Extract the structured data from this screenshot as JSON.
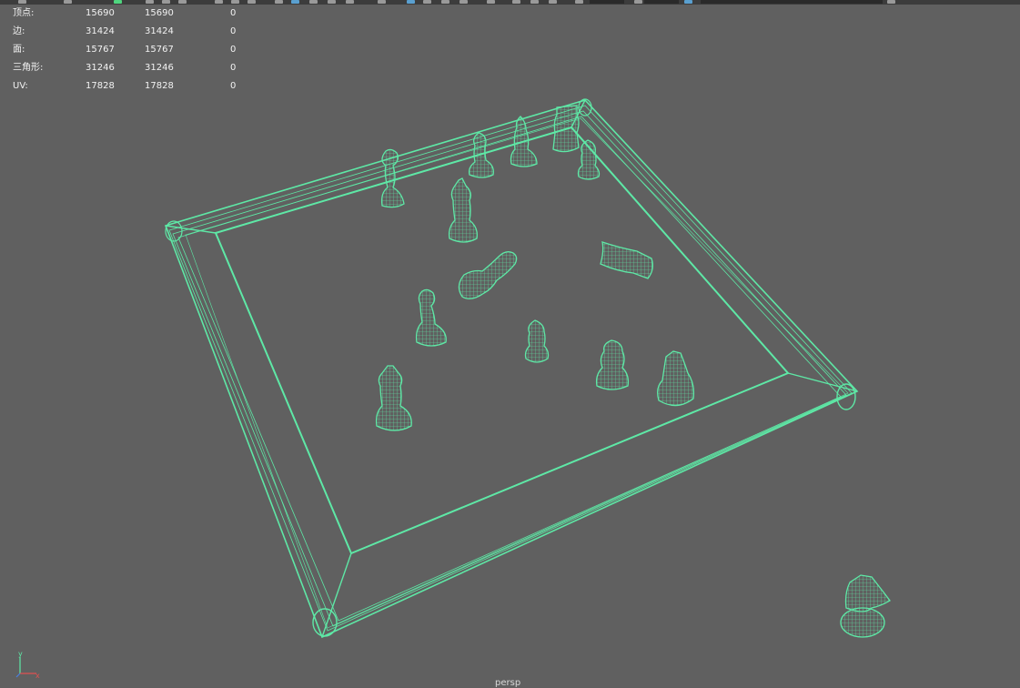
{
  "stats": {
    "rows": [
      {
        "label": "顶点:",
        "v1": "15690",
        "v2": "15690",
        "v3": "0"
      },
      {
        "label": "边:",
        "v1": "31424",
        "v2": "31424",
        "v3": "0"
      },
      {
        "label": "面:",
        "v1": "15767",
        "v2": "15767",
        "v3": "0"
      },
      {
        "label": "三角形:",
        "v1": "31246",
        "v2": "31246",
        "v3": "0"
      },
      {
        "label": "UV:",
        "v1": "17828",
        "v2": "17828",
        "v3": "0"
      }
    ]
  },
  "camera": {
    "label": "persp"
  },
  "axis": {
    "y": "y",
    "x": "x"
  },
  "colors": {
    "wireframe": "#5ee8a6",
    "background": "#606060"
  }
}
